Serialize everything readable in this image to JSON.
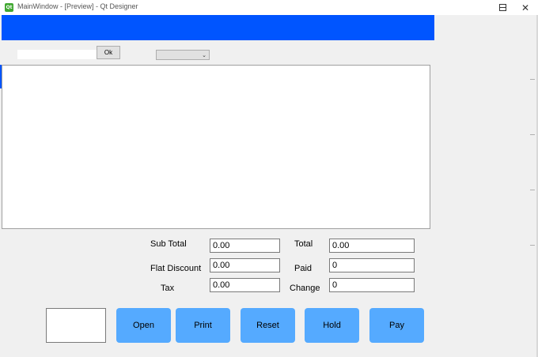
{
  "window": {
    "title": "MainWindow - [Preview] - Qt Designer",
    "icon": "qt-app-icon",
    "controls": {
      "minimize": "minimize-icon",
      "maximize": "maximize-icon",
      "close": "close-icon"
    }
  },
  "toolbar": {
    "search_value": "",
    "ok_label": "Ok",
    "combo_value": ""
  },
  "totals": {
    "sub_total": {
      "label": "Sub Total",
      "value": "0.00"
    },
    "flat_discount": {
      "label": "Flat Discount",
      "value": "0.00"
    },
    "tax": {
      "label": "Tax",
      "value": "0.00"
    },
    "total": {
      "label": "Total",
      "value": "0.00"
    },
    "paid": {
      "label": "Paid",
      "value": "0"
    },
    "change": {
      "label": "Change",
      "value": "0"
    }
  },
  "actions": {
    "open": "Open",
    "print": "Print",
    "reset": "Reset",
    "hold": "Hold",
    "pay": "Pay"
  },
  "colors": {
    "header_blue": "#0055ff",
    "button_blue": "#55aaff"
  }
}
